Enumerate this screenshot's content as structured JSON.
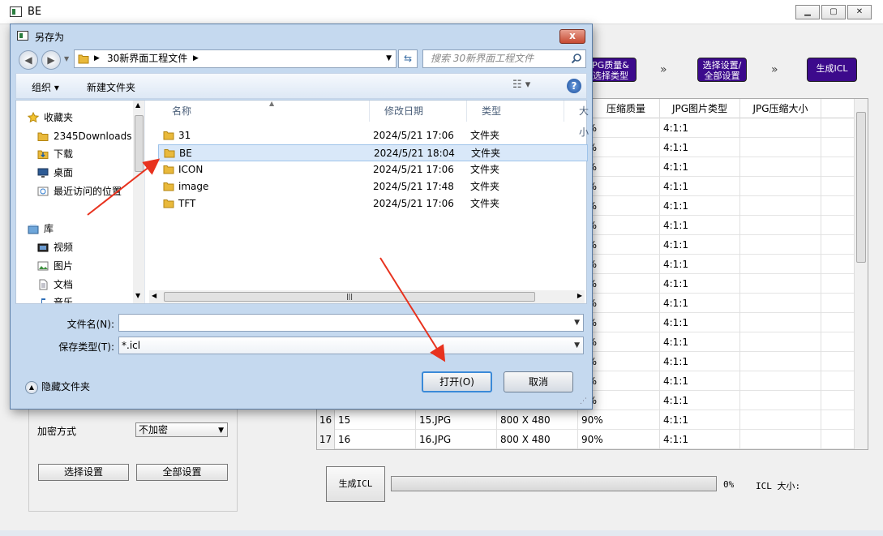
{
  "app": {
    "title": "BE",
    "steps": [
      "PG质量&\n选择类型",
      "选择设置/\n全部设置",
      "生成ICL"
    ],
    "step_separator": "»",
    "table": {
      "headers": [
        "压缩质量",
        "JPG图片类型",
        "JPG压缩大小"
      ],
      "top_rows": [
        [
          "0%",
          "4:1:1"
        ],
        [
          "0%",
          "4:1:1"
        ],
        [
          "0%",
          "4:1:1"
        ],
        [
          "0%",
          "4:1:1"
        ],
        [
          "0%",
          "4:1:1"
        ],
        [
          "0%",
          "4:1:1"
        ],
        [
          "0%",
          "4:1:1"
        ],
        [
          "0%",
          "4:1:1"
        ],
        [
          "0%",
          "4:1:1"
        ],
        [
          "0%",
          "4:1:1"
        ],
        [
          "0%",
          "4:1:1"
        ],
        [
          "0%",
          "4:1:1"
        ],
        [
          "0%",
          "4:1:1"
        ],
        [
          "0%",
          "4:1:1"
        ],
        [
          "0%",
          "4:1:1"
        ]
      ],
      "bottom_rows": [
        {
          "num": "16",
          "id": "15",
          "file": "15.JPG",
          "size": "800 X 480",
          "quality": "90%",
          "type": "4:1:1"
        },
        {
          "num": "17",
          "id": "16",
          "file": "16.JPG",
          "size": "800 X 480",
          "quality": "90%",
          "type": "4:1:1"
        }
      ]
    },
    "encrypt_label": "加密方式",
    "encrypt_value": "不加密",
    "select_settings_button": "选择设置",
    "all_settings_button": "全部设置",
    "generate_button": "生成ICL",
    "progress_percent": "0%",
    "progress_value": 0,
    "icl_size_label": "ICL 大小:"
  },
  "dialog": {
    "title": "另存为",
    "close_label": "x",
    "address_path": [
      "30新界面工程文件"
    ],
    "search_placeholder": "搜索 30新界面工程文件",
    "organize_label": "组织 ▾",
    "new_folder_label": "新建文件夹",
    "nav_items": [
      {
        "label": "收藏夹",
        "icon": "star-icon"
      },
      {
        "label": "2345Downloads",
        "icon": "folder-icon"
      },
      {
        "label": "下载",
        "icon": "download-folder-icon"
      },
      {
        "label": "桌面",
        "icon": "desktop-icon"
      },
      {
        "label": "最近访问的位置",
        "icon": "recent-places-icon"
      },
      {
        "label": "库",
        "icon": "library-icon"
      },
      {
        "label": "视频",
        "icon": "video-icon"
      },
      {
        "label": "图片",
        "icon": "picture-icon"
      },
      {
        "label": "文档",
        "icon": "document-icon"
      },
      {
        "label": "音乐",
        "icon": "music-icon"
      }
    ],
    "columns": [
      "名称",
      "修改日期",
      "类型",
      "大小"
    ],
    "files": [
      {
        "name": "31",
        "date": "2024/5/21 17:06",
        "type": "文件夹",
        "selected": false
      },
      {
        "name": "BE",
        "date": "2024/5/21 18:04",
        "type": "文件夹",
        "selected": true
      },
      {
        "name": "ICON",
        "date": "2024/5/21 17:06",
        "type": "文件夹",
        "selected": false
      },
      {
        "name": "image",
        "date": "2024/5/21 17:48",
        "type": "文件夹",
        "selected": false
      },
      {
        "name": "TFT",
        "date": "2024/5/21 17:06",
        "type": "文件夹",
        "selected": false
      }
    ],
    "filename_label": "文件名(N):",
    "filename_value": "",
    "filetype_label": "保存类型(T):",
    "filetype_value": "*.icl",
    "open_button": "打开(O)",
    "cancel_button": "取消",
    "hide_folders_label": "隐藏文件夹"
  },
  "colors": {
    "step_bg": "#3c0a8c",
    "selection_bg": "#d9e8f9",
    "dialog_frame": "#c5d9ef",
    "annotation_arrow": "#e8321e"
  }
}
